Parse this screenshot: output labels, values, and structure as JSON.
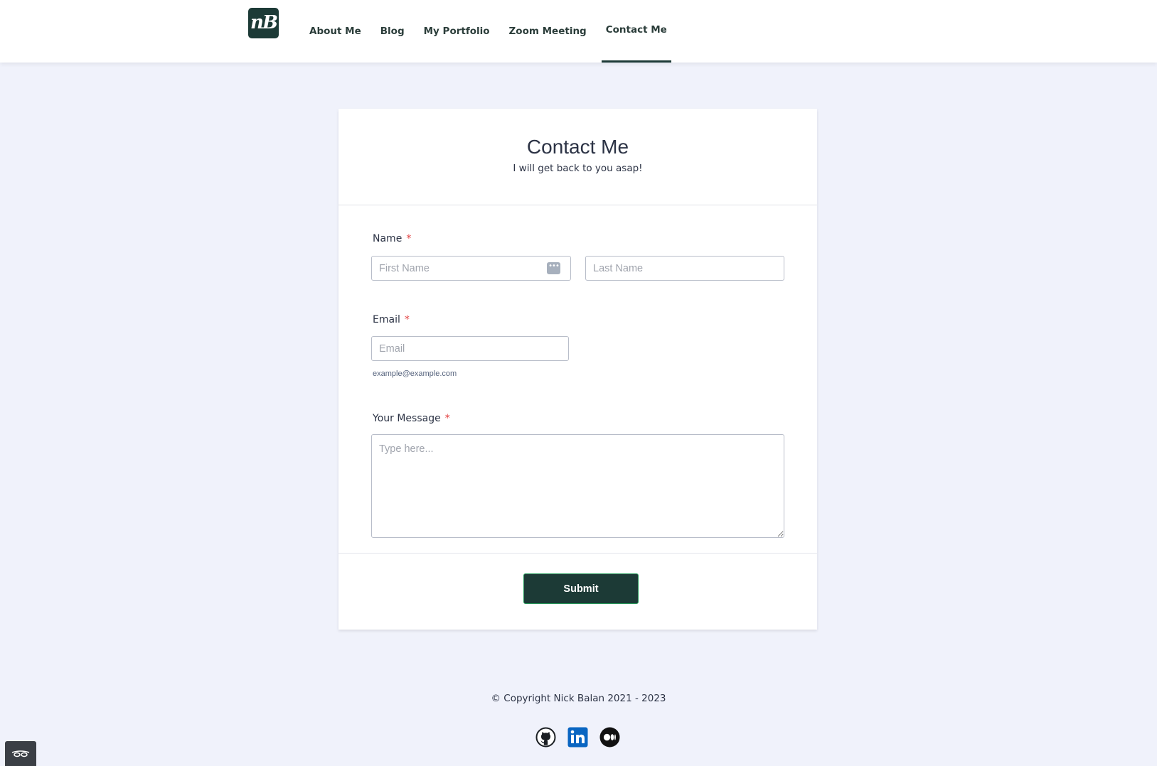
{
  "brand": {
    "logo_text": "nB"
  },
  "nav": {
    "items": [
      {
        "label": "About Me"
      },
      {
        "label": "Blog"
      },
      {
        "label": "My Portfolio"
      },
      {
        "label": "Zoom Meeting"
      },
      {
        "label": "Contact Me",
        "active": true
      }
    ]
  },
  "form": {
    "title": "Contact Me",
    "subtitle": "I will get back to you asap!",
    "name_label": "Name",
    "required_mark": "*",
    "first_name_placeholder": "First Name",
    "first_name_value": "",
    "last_name_placeholder": "Last Name",
    "last_name_value": "",
    "email_label": "Email",
    "email_placeholder": "Email",
    "email_value": "",
    "email_helper": "example@example.com",
    "message_label": "Your Message",
    "message_placeholder": "Type here...",
    "message_value": "",
    "submit_label": "Submit"
  },
  "footer": {
    "copyright": "© Copyright Nick Balan 2021 - 2023",
    "social": [
      {
        "icon": "github-icon"
      },
      {
        "icon": "linkedin-icon"
      },
      {
        "icon": "medium-icon"
      }
    ]
  },
  "colors": {
    "brand": "#1c3a36",
    "page_background": "#f0f2fb",
    "required": "#e34040",
    "linkedin": "#0a66c2"
  }
}
